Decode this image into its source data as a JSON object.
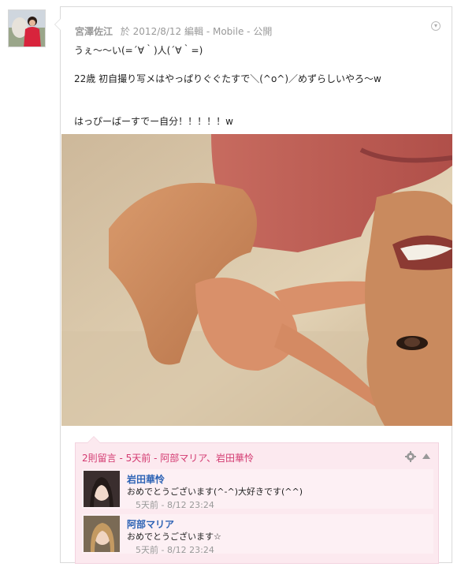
{
  "post": {
    "author": "宮澤佐江",
    "date": "於 2012/8/12 編輯",
    "sep": " - ",
    "source": "Mobile",
    "visibility": "公開",
    "lines": [
      "うぇ～～い(=´∀｀)人(´∀｀=)",
      "",
      "22歳 初自撮り写メはやっぱりぐぐたすで＼(^o^)／めずらしいやろ〜w",
      "",
      "",
      "はっぴーばーすでー自分！！！！！w"
    ]
  },
  "comments_summary": {
    "count": "2則留言",
    "ago": "5天前",
    "people": "阿部マリア、岩田華怜"
  },
  "comments": [
    {
      "name": "岩田華怜",
      "text": "おめでとうございます(^-^)大好きです(^^)",
      "time": "5天前 - 8/12 23:24"
    },
    {
      "name": "阿部マリア",
      "text": "おめでとうございます☆",
      "time": "5天前 - 8/12 23:24"
    }
  ],
  "icons": [
    "avatar",
    "chevron-down-icon",
    "gear-icon",
    "collapse-icon"
  ],
  "colors": {
    "accent": "#d33970",
    "name_link": "#2d63b5",
    "comment_bg": "#fce9ef"
  }
}
